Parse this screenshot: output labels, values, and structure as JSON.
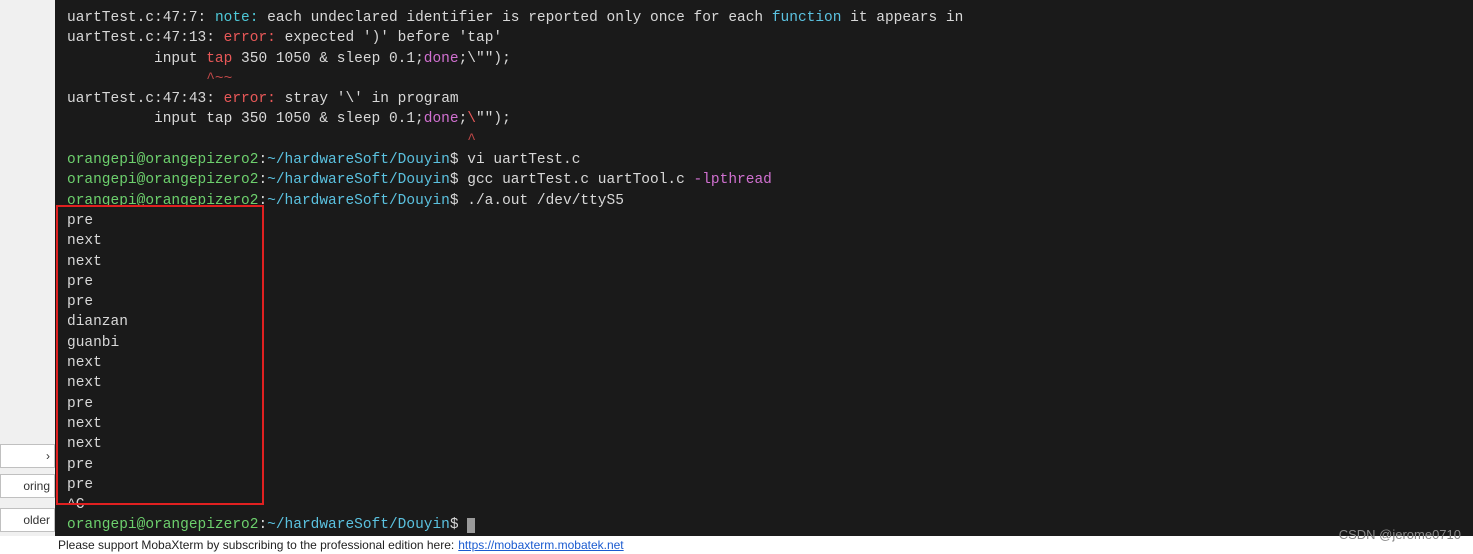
{
  "terminal": {
    "compiler_lines": [
      {
        "segments": [
          {
            "cls": "c-white",
            "text": "uartTest.c:47:7: "
          },
          {
            "cls": "c-cyan",
            "text": "note: "
          },
          {
            "cls": "c-white",
            "text": "each undeclared identifier is reported only once for each "
          },
          {
            "cls": "c-brightblue",
            "text": "function"
          },
          {
            "cls": "c-white",
            "text": " it appears in"
          }
        ]
      },
      {
        "segments": [
          {
            "cls": "c-white",
            "text": "uartTest.c:47:13: "
          },
          {
            "cls": "c-red",
            "text": "error: "
          },
          {
            "cls": "c-white",
            "text": "expected ')' before 'tap'"
          }
        ]
      },
      {
        "segments": [
          {
            "cls": "c-white",
            "text": "          input "
          },
          {
            "cls": "c-red",
            "text": "tap"
          },
          {
            "cls": "c-white",
            "text": " 350 1050 & sleep 0.1;"
          },
          {
            "cls": "c-magenta",
            "text": "done"
          },
          {
            "cls": "c-white",
            "text": ";\\\"\");"
          }
        ]
      },
      {
        "segments": [
          {
            "cls": "c-darkred",
            "text": "                ^~~"
          }
        ]
      },
      {
        "segments": [
          {
            "cls": "c-white",
            "text": "uartTest.c:47:43: "
          },
          {
            "cls": "c-red",
            "text": "error: "
          },
          {
            "cls": "c-white",
            "text": "stray '\\' in program"
          }
        ]
      },
      {
        "segments": [
          {
            "cls": "c-white",
            "text": "          input tap 350 1050 & sleep 0.1;"
          },
          {
            "cls": "c-magenta",
            "text": "done"
          },
          {
            "cls": "c-white",
            "text": ";"
          },
          {
            "cls": "c-red",
            "text": "\\"
          },
          {
            "cls": "c-white",
            "text": "\"\");"
          }
        ]
      },
      {
        "segments": [
          {
            "cls": "c-darkred",
            "text": "                                              ^"
          }
        ]
      }
    ],
    "prompt_lines": [
      {
        "user": "orangepi@orangepizero2",
        "path": "~/hardwareSoft/Douyin",
        "cmd_segments": [
          {
            "cls": "c-white",
            "text": "vi uartTest.c"
          }
        ]
      },
      {
        "user": "orangepi@orangepizero2",
        "path": "~/hardwareSoft/Douyin",
        "cmd_segments": [
          {
            "cls": "c-white",
            "text": "gcc uartTest.c uartTool.c "
          },
          {
            "cls": "c-magenta",
            "text": "-lpthread"
          }
        ]
      },
      {
        "user": "orangepi@orangepizero2",
        "path": "~/hardwareSoft/Douyin",
        "cmd_segments": [
          {
            "cls": "c-white",
            "text": "./a.out /dev/ttyS5"
          }
        ]
      }
    ],
    "output_lines": [
      "pre",
      "next",
      "next",
      "pre",
      "pre",
      "dianzan",
      "guanbi",
      "next",
      "next",
      "pre",
      "next",
      "next",
      "pre",
      "pre",
      "^C"
    ],
    "final_prompt": {
      "user": "orangepi@orangepizero2",
      "path": "~/hardwareSoft/Douyin"
    }
  },
  "left_panel": {
    "chevron": "›",
    "btn1": "oring",
    "btn2": "older"
  },
  "bottom": {
    "text_prefix": "Please support MobaXterm by subscribing to the professional edition here: ",
    "link": "https://mobaxterm.mobatek.net"
  },
  "watermark": "CSDN @jerome0710"
}
